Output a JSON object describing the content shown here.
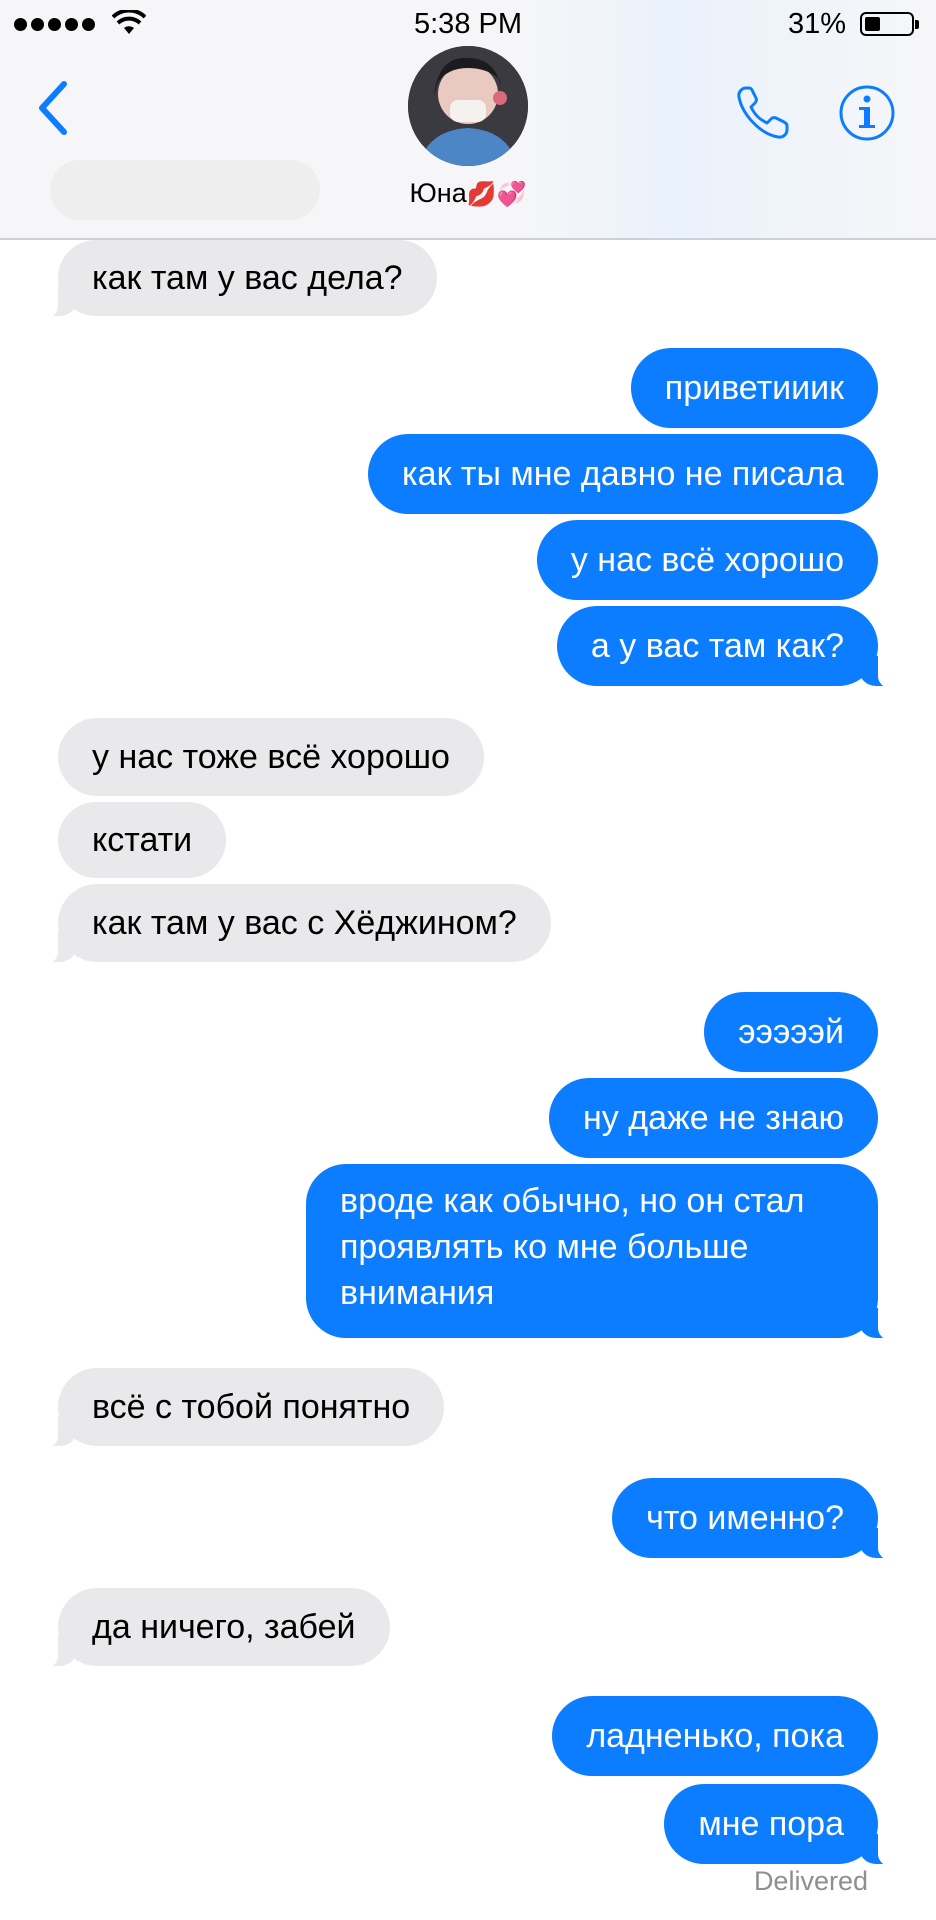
{
  "status_bar": {
    "time": "5:38 PM",
    "battery": "31%"
  },
  "header": {
    "contact_name": "Юна",
    "contact_emoji": "💋💞",
    "back_icon": "chevron-left-icon",
    "call_icon": "phone-icon",
    "info_icon": "info-icon",
    "accent_color": "#0b7dfe"
  },
  "messages": [
    {
      "from": "them",
      "text": "как там у вас дела?"
    },
    {
      "from": "me",
      "text": "приветииик"
    },
    {
      "from": "me",
      "text": "как ты мне давно не писала"
    },
    {
      "from": "me",
      "text": "у нас всё хорошо"
    },
    {
      "from": "me",
      "text": "а у вас там как?"
    },
    {
      "from": "them",
      "text": "у нас тоже всё хорошо"
    },
    {
      "from": "them",
      "text": "кстати"
    },
    {
      "from": "them",
      "text": "как там у вас с Хёджином?"
    },
    {
      "from": "me",
      "text": "эээээй"
    },
    {
      "from": "me",
      "text": "ну даже не знаю"
    },
    {
      "from": "me",
      "text": "вроде как обычно, но он стал проявлять ко мне больше внимания"
    },
    {
      "from": "them",
      "text": "всё с тобой понятно"
    },
    {
      "from": "me",
      "text": "что именно?"
    },
    {
      "from": "them",
      "text": "да ничего, забей"
    },
    {
      "from": "me",
      "text": "ладненько, пока"
    },
    {
      "from": "me",
      "text": "мне пора"
    }
  ],
  "delivered_label": "Delivered",
  "colors": {
    "incoming_bubble": "#e9e9eb",
    "outgoing_bubble": "#0b7dfe"
  }
}
